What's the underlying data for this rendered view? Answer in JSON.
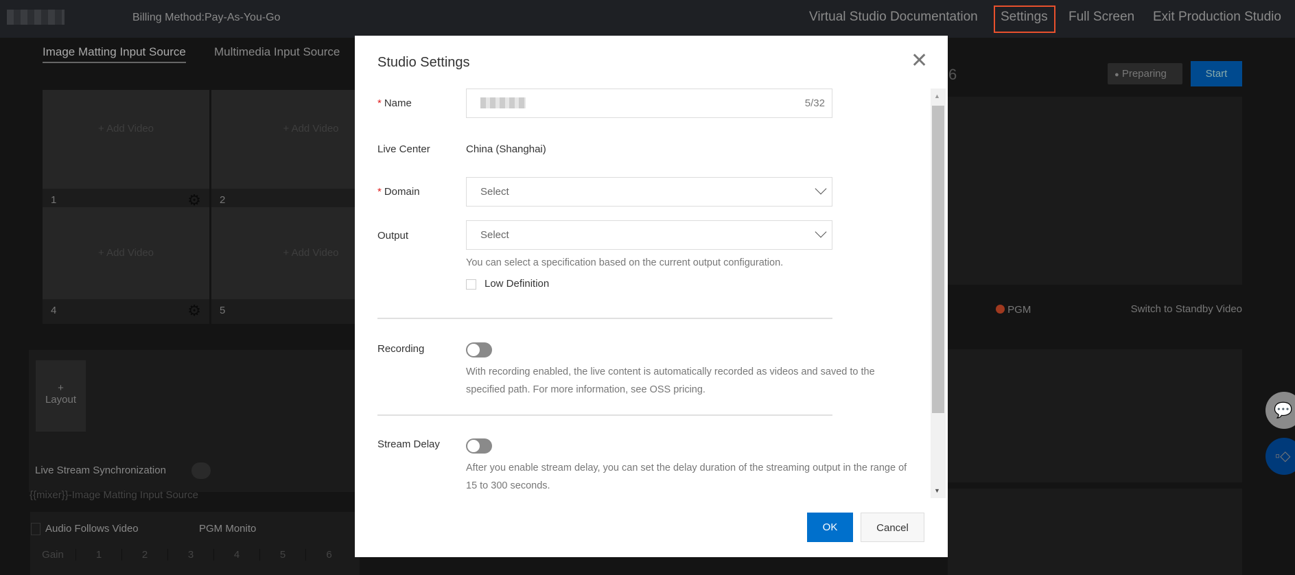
{
  "header": {
    "billing": "Billing Method:Pay-As-You-Go",
    "links": [
      "Virtual Studio Documentation",
      "Settings",
      "Full Screen",
      "Exit Production Studio"
    ],
    "highlight_color": "#e8512d"
  },
  "left": {
    "tabs": [
      "Image Matting Input Source",
      "Multimedia Input Source"
    ],
    "tiles": [
      {
        "n": "1",
        "label": "+ Add Video"
      },
      {
        "n": "2",
        "label": "+ Add Video"
      },
      {
        "n": "4",
        "label": "+ Add Video"
      },
      {
        "n": "5",
        "label": "+ Add Video"
      }
    ],
    "layout_btn": {
      "plus": "+",
      "label": "Layout"
    },
    "sync_label": "Live Stream Synchronization",
    "mixer_title": "{{mixer}}-Image Matting Input Source",
    "audio_follows": "Audio Follows Video",
    "pgm_monitor": "PGM Monito",
    "gain_row": [
      "Gain",
      "1",
      "2",
      "3",
      "4",
      "5",
      "6"
    ]
  },
  "right": {
    "title_fragment": "6",
    "status": "Preparing",
    "start": "Start",
    "pgm": "PGM",
    "switch_standby": "Switch to Standby Video",
    "pgm_color": "#a0391f",
    "accent": "#004a8f"
  },
  "modal": {
    "title": "Studio Settings",
    "name_label": "Name",
    "name_count": "5/32",
    "live_center_label": "Live Center",
    "live_center_value": "China (Shanghai)",
    "domain_label": "Domain",
    "domain_placeholder": "Select",
    "output_label": "Output",
    "output_placeholder": "Select",
    "output_hint": "You can select a specification based on the current output configuration.",
    "low_def": "Low Definition",
    "low_def_checked": false,
    "recording_label": "Recording",
    "recording_on": false,
    "recording_desc": "With recording enabled, the live content is automatically recorded as videos and saved to the specified path. For more information, see OSS pricing.",
    "delay_label": "Stream Delay",
    "delay_on": false,
    "delay_desc": "After you enable stream delay, you can set the delay duration of the streaming output in the range of 15 to 300 seconds.",
    "ok": "OK",
    "cancel": "Cancel",
    "primary_color": "#0070cc"
  }
}
